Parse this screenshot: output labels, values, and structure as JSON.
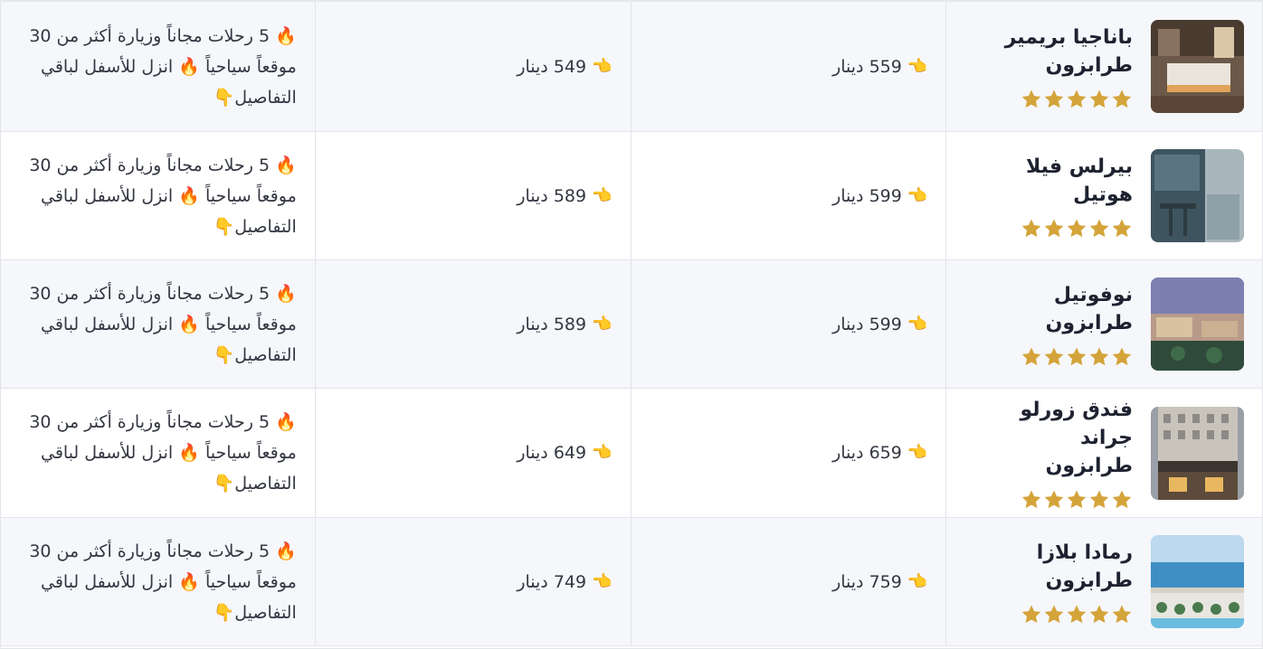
{
  "colors": {
    "star": "#d4a43a",
    "row_odd": "#f6f7fb",
    "row_even": "#ffffff",
    "border": "#e3e5ea",
    "text": "#333741"
  },
  "icons": {
    "pointer": "👈",
    "fire": "🔥",
    "down": "👇"
  },
  "rows": [
    {
      "hotel_name": "باناجيا بريمير طرابزون",
      "stars": 5,
      "price_1": "559 دينار",
      "price_2": "549 دينار",
      "offer_part1": "5 رحلات مجاناً وزيارة أكثر من 30 موقعاً سياحياً",
      "offer_part2": "انزل للأسفل لباقي التفاصيل"
    },
    {
      "hotel_name": "بيرلس فيلا هوتيل",
      "stars": 5,
      "price_1": "599 دينار",
      "price_2": "589 دينار",
      "offer_part1": "5 رحلات مجاناً وزيارة أكثر من 30 موقعاً سياحياً",
      "offer_part2": "انزل للأسفل لباقي التفاصيل"
    },
    {
      "hotel_name": "نوفوتيل طرابزون",
      "stars": 5,
      "price_1": "599 دينار",
      "price_2": "589 دينار",
      "offer_part1": "5 رحلات مجاناً وزيارة أكثر من 30 موقعاً سياحياً",
      "offer_part2": "انزل للأسفل لباقي التفاصيل"
    },
    {
      "hotel_name": "فندق زورلو جراند طرابزون",
      "stars": 5,
      "price_1": "659 دينار",
      "price_2": "649 دينار",
      "offer_part1": "5 رحلات مجاناً وزيارة أكثر من 30 موقعاً سياحياً",
      "offer_part2": "انزل للأسفل لباقي التفاصيل"
    },
    {
      "hotel_name": "رمادا بلازا طرابزون",
      "stars": 5,
      "price_1": "759 دينار",
      "price_2": "749 دينار",
      "offer_part1": "5 رحلات مجاناً وزيارة أكثر من 30 موقعاً سياحياً",
      "offer_part2": "انزل للأسفل لباقي التفاصيل"
    }
  ]
}
